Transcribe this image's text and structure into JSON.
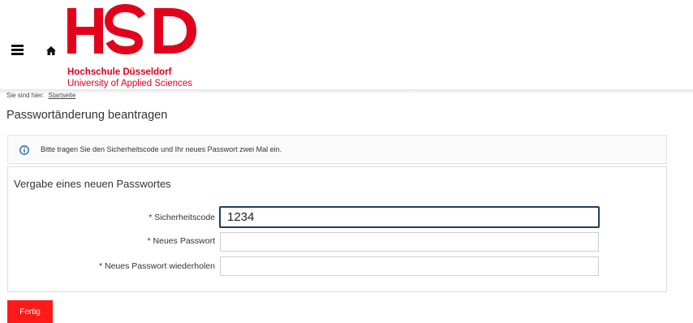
{
  "header": {
    "menu_icon": "hamburger-menu-icon",
    "home_icon": "home-icon",
    "logo": {
      "letters": "HSD",
      "line1": "Hochschule Düsseldorf",
      "line2": "University of Applied Sciences",
      "color": "#e3001b"
    }
  },
  "breadcrumb": {
    "prefix": "Sie sind hier:",
    "link": "Startseite"
  },
  "page_title": "Passwortänderung beantragen",
  "info": {
    "icon": "info-circle-icon",
    "text": "Bitte tragen Sie den Sicherheitscode und Ihr neues Passwort zwei Mal ein."
  },
  "form": {
    "legend": "Vergabe eines neuen Passwortes",
    "fields": [
      {
        "label": "* Sicherheitscode",
        "value": "1234",
        "focused": true
      },
      {
        "label": "* Neues Passwort",
        "value": ""
      },
      {
        "label": "* Neues Passwort wiederholen",
        "value": ""
      }
    ]
  },
  "submit_label": "Fertig",
  "colors": {
    "accent": "#e3001b",
    "button": "#ff1a1a",
    "focus_border": "#1f3f5f"
  }
}
